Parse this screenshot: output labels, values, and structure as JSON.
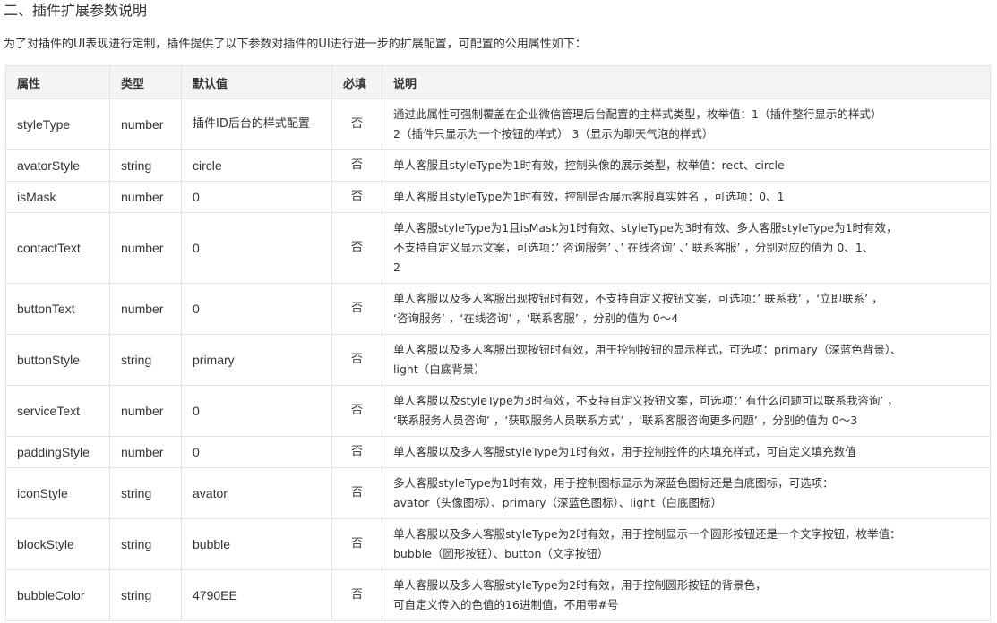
{
  "section_title": "二、插件扩展参数说明",
  "intro": "为了对插件的UI表现进行定制，插件提供了以下参数对插件的UI进行进一步的扩展配置，可配置的公用属性如下：",
  "table": {
    "headers": [
      "属性",
      "类型",
      "默认值",
      "必填",
      "说明"
    ],
    "rows": [
      {
        "prop": "styleType",
        "type": "number",
        "default": "插件ID后台的样式配置",
        "required": "否",
        "desc": "通过此属性可强制覆盖在企业微信管理后台配置的主样式类型，枚举值：1（插件整行显示的样式）\n2（插件只显示为一个按钮的样式） 3（显示为聊天气泡的样式）"
      },
      {
        "prop": "avatorStyle",
        "type": "string",
        "default": "circle",
        "required": "否",
        "desc": "单人客服且styleType为1时有效，控制头像的展示类型，枚举值：rect、circle"
      },
      {
        "prop": "isMask",
        "type": "number",
        "default": "0",
        "required": "否",
        "desc": "单人客服且styleType为1时有效，控制是否展示客服真实姓名 ，可选项：0、1"
      },
      {
        "prop": "contactText",
        "type": "number",
        "default": "0",
        "required": "否",
        "desc": "单人客服styleType为1且isMask为1时有效、styleType为3时有效、多人客服styleType为1时有效，\n不支持自定义显示文案，可选项：’ 咨询服务’ 、’ 在线咨询’ 、’ 联系客服’ ，分别对应的值为 0、1、\n2"
      },
      {
        "prop": "buttonText",
        "type": "number",
        "default": "0",
        "required": "否",
        "desc": "单人客服以及多人客服出现按钮时有效，不支持自定义按钮文案，可选项：’ 联系我’ ，‘立即联系’ ，\n‘咨询服务’ ，‘在线咨询’ ，‘联系客服’ ，分别的值为 0～4"
      },
      {
        "prop": "buttonStyle",
        "type": "string",
        "default": "primary",
        "required": "否",
        "desc": "单人客服以及多人客服出现按钮时有效，用于控制按钮的显示样式，可选项：primary（深蓝色背景）、\nlight（白底背景）"
      },
      {
        "prop": "serviceText",
        "type": "number",
        "default": "0",
        "required": "否",
        "desc": "单人客服以及styleType为3时有效，不支持自定义按钮文案，可选项：’ 有什么问题可以联系我咨询’ ，\n‘联系服务人员咨询’ ，‘获取服务人员联系方式’ ，‘联系客服咨询更多问题’ ，分别的值为 0～3"
      },
      {
        "prop": "paddingStyle",
        "type": "number",
        "default": "0",
        "required": "否",
        "desc": "单人客服以及多人客服styleType为1时有效，用于控制控件的内填充样式，可自定义填充数值"
      },
      {
        "prop": "iconStyle",
        "type": "string",
        "default": "avator",
        "required": "否",
        "desc": "多人客服styleType为1时有效，用于控制图标显示为深蓝色图标还是白底图标，可选项：\navator（头像图标）、primary（深蓝色图标）、light（白底图标）"
      },
      {
        "prop": "blockStyle",
        "type": "string",
        "default": "bubble",
        "required": "否",
        "desc": "单人客服以及多人客服styleType为2时有效，用于控制显示一个圆形按钮还是一个文字按钮，枚举值：\nbubble（圆形按钮）、button（文字按钮）"
      },
      {
        "prop": "bubbleColor",
        "type": "string",
        "default": "4790EE",
        "required": "否",
        "desc": "单人客服以及多人客服styleType为2时有效，用于控制圆形按钮的背景色，\n可自定义传入的色值的16进制值，不用带#号"
      }
    ]
  }
}
